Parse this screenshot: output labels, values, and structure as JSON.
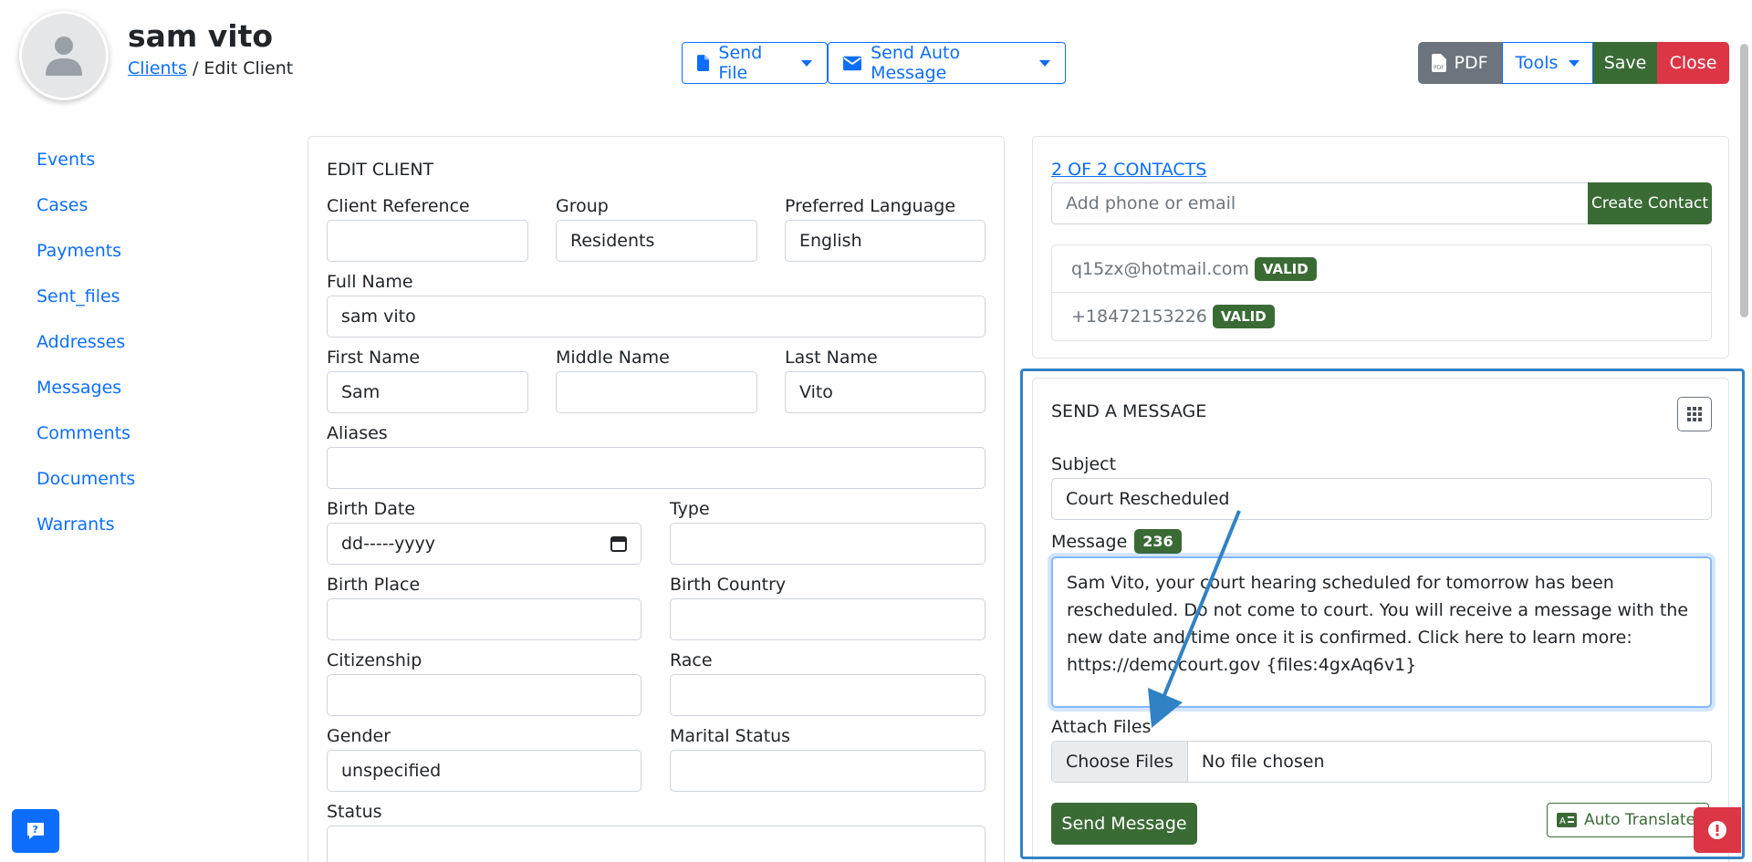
{
  "header": {
    "client_name": "sam vito",
    "breadcrumb_link": "Clients",
    "breadcrumb_sep": " / ",
    "breadcrumb_current": "Edit Client",
    "send_file_label": "Send File",
    "send_auto_message_label": "Send Auto Message",
    "pdf_label": "PDF",
    "tools_label": "Tools",
    "save_label": "Save",
    "close_label": "Close"
  },
  "sidebar": {
    "items": [
      {
        "label": "Events"
      },
      {
        "label": "Cases"
      },
      {
        "label": "Payments"
      },
      {
        "label": "Sent_files"
      },
      {
        "label": "Addresses"
      },
      {
        "label": "Messages"
      },
      {
        "label": "Comments"
      },
      {
        "label": "Documents"
      },
      {
        "label": "Warrants"
      }
    ]
  },
  "edit_client": {
    "title": "EDIT CLIENT",
    "client_reference": {
      "label": "Client Reference",
      "value": ""
    },
    "group": {
      "label": "Group",
      "value": "Residents"
    },
    "preferred_language": {
      "label": "Preferred Language",
      "value": "English"
    },
    "full_name": {
      "label": "Full Name",
      "value": "sam vito"
    },
    "first_name": {
      "label": "First Name",
      "value": "Sam"
    },
    "middle_name": {
      "label": "Middle Name",
      "value": ""
    },
    "last_name": {
      "label": "Last Name",
      "value": "Vito"
    },
    "aliases": {
      "label": "Aliases",
      "value": ""
    },
    "birth_date": {
      "label": "Birth Date",
      "value": "dd-----yyyy"
    },
    "type": {
      "label": "Type",
      "value": ""
    },
    "birth_place": {
      "label": "Birth Place",
      "value": ""
    },
    "birth_country": {
      "label": "Birth Country",
      "value": ""
    },
    "citizenship": {
      "label": "Citizenship",
      "value": ""
    },
    "race": {
      "label": "Race",
      "value": ""
    },
    "gender": {
      "label": "Gender",
      "value": "unspecified"
    },
    "marital_status": {
      "label": "Marital Status",
      "value": ""
    },
    "status": {
      "label": "Status",
      "value": ""
    }
  },
  "contacts": {
    "title": "2 OF 2 CONTACTS",
    "input_placeholder": "Add phone or email",
    "create_label": "Create Contact",
    "list": [
      {
        "value": "q15zx@hotmail.com",
        "badge": "VALID"
      },
      {
        "value": "+18472153226",
        "badge": "VALID"
      }
    ]
  },
  "send_message": {
    "title": "SEND A MESSAGE",
    "subject_label": "Subject",
    "subject_value": "Court Rescheduled",
    "message_label": "Message",
    "char_count": "236",
    "message_value": "Sam Vito, your court hearing scheduled for tomorrow has been rescheduled. Do not come to court. You will receive a message with the new date and time once it is confirmed. Click here to learn more: https://democourt.gov {files:4gxAq6v1}",
    "attach_label": "Attach Files",
    "choose_files_label": "Choose Files",
    "no_file_label": "No file chosen",
    "send_label": "Send Message",
    "auto_translate_label": "Auto Translate"
  },
  "colors": {
    "primary": "#0d6efd",
    "success": "#3a6b35",
    "danger": "#dc3545",
    "secondary": "#6c757d",
    "annotation": "#3182c4"
  },
  "icons": [
    "avatar-person-icon",
    "file-icon",
    "envelope-icon",
    "pdf-icon",
    "grid-icon",
    "translate-icon",
    "help-icon",
    "alert-icon",
    "calendar-icon",
    "annotation-arrow"
  ]
}
